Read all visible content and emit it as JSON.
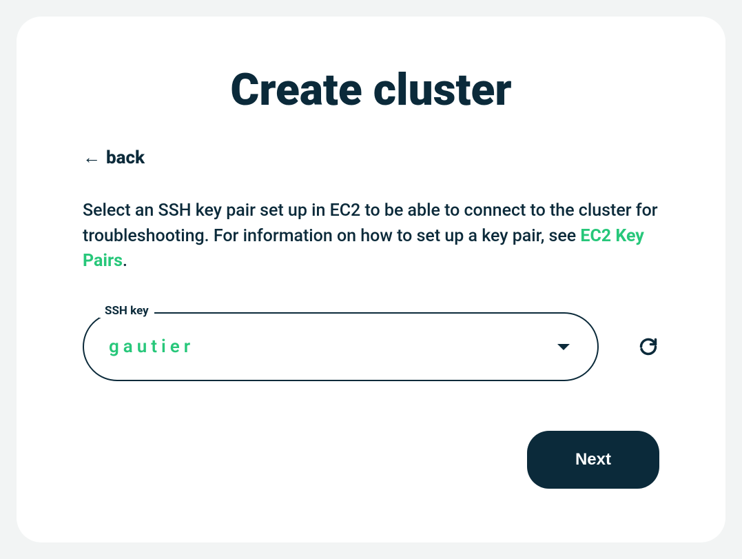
{
  "page_title": "Create cluster",
  "back_label": "back",
  "description_part1": "Select an SSH key pair set up in EC2 to be able to connect to the cluster for troubleshooting. For information on how to set up a key pair, see ",
  "description_link": "EC2 Key Pairs",
  "description_part2": ".",
  "ssh_key": {
    "label": "SSH key",
    "value": "gautier"
  },
  "next_button": "Next"
}
